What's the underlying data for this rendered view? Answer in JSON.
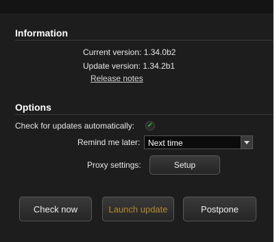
{
  "information": {
    "title": "Information",
    "current_version": "Current version: 1.34.0b2",
    "update_version": "Update version: 1.34.2b1",
    "release_notes": "Release notes"
  },
  "options": {
    "title": "Options",
    "auto_check_label": "Check for updates automatically:",
    "auto_check_checked": true,
    "remind_label": "Remind me later:",
    "remind_value": "Next time",
    "proxy_label": "Proxy settings:",
    "setup_button": "Setup"
  },
  "actions": {
    "check_now": "Check now",
    "launch_update": "Launch update",
    "postpone": "Postpone"
  },
  "colors": {
    "background": "#1d1d1d",
    "check_green": "#34c030",
    "launch_disabled_text": "#b68a2e"
  }
}
